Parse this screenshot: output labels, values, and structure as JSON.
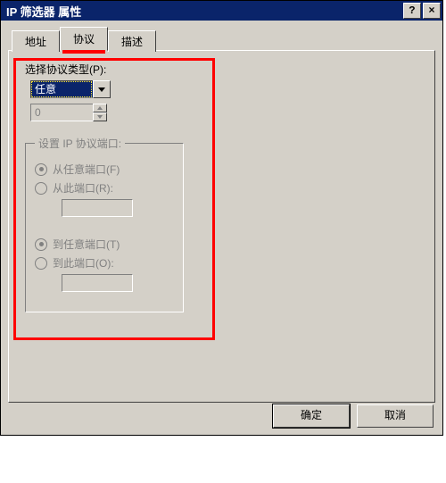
{
  "title": "IP 筛选器 属性",
  "titlebar_buttons": {
    "help": "?",
    "close": "×"
  },
  "tabs": {
    "address": "地址",
    "protocol": "协议",
    "description": "描述"
  },
  "protocol_type_label": "选择协议类型(P):",
  "protocol_combo_value": "任意",
  "protocol_number_value": "0",
  "port_group_legend": "设置 IP 协议端口:",
  "from_any_port": "从任意端口(F)",
  "from_this_port": "从此端口(R):",
  "to_any_port": "到任意端口(T)",
  "to_this_port": "到此端口(O):",
  "buttons": {
    "ok": "确定",
    "cancel": "取消"
  }
}
